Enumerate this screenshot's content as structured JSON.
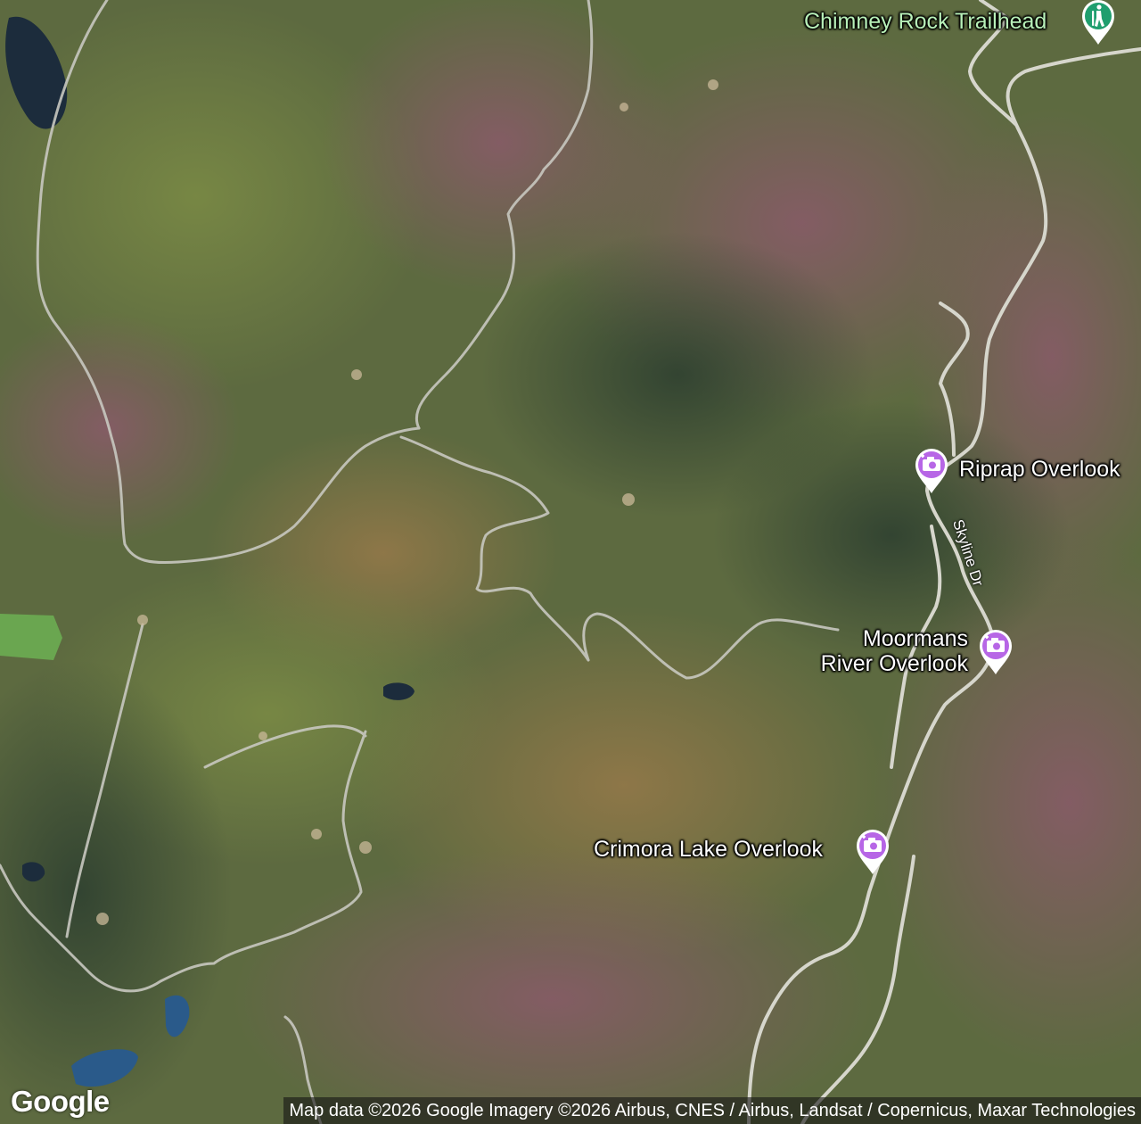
{
  "map": {
    "type": "satellite",
    "colors": {
      "pin_poi": "#b766e6",
      "pin_trail": "#1f9e6e",
      "road": "#c8c8c0"
    }
  },
  "places": [
    {
      "name": "Chimney Rock Trailhead",
      "icon": "hiker-icon",
      "category": "trailhead"
    },
    {
      "name": "Riprap Overlook",
      "icon": "camera-icon",
      "category": "viewpoint"
    },
    {
      "name_line1": "Moormans",
      "name_line2": "River Overlook",
      "icon": "camera-icon",
      "category": "viewpoint"
    },
    {
      "name": "Crimora Lake Overlook",
      "icon": "camera-icon",
      "category": "viewpoint"
    }
  ],
  "roads": [
    {
      "name": "Skyline Dr"
    }
  ],
  "footer": {
    "logo": "Google",
    "attribution": "Map data ©2026 Google Imagery ©2026 Airbus, CNES / Airbus, Landsat / Copernicus, Maxar Technologies"
  }
}
